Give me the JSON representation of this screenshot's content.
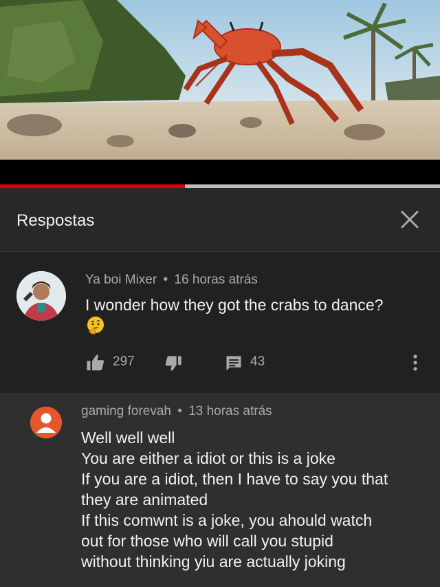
{
  "video": {
    "progress_fraction": 0.42,
    "accent_color": "#e00000"
  },
  "panel": {
    "title": "Respostas",
    "close_icon": "close-icon"
  },
  "parent_comment": {
    "author": "Ya boi Mixer",
    "separator": "•",
    "time": "16 horas atrás",
    "text": "I wonder how they got the crabs to dance?",
    "emoji": "thinking-face-emoji",
    "likes": "297",
    "replies": "43"
  },
  "reply_comment": {
    "author": "gaming forevah",
    "separator": "•",
    "time": "13 horas atrás",
    "lines": [
      "Well well well",
      "You are either a idiot or this is a joke",
      "If you are a idiot, then I have to say you that",
      "they are animated",
      "If this comwnt is a joke, you ahould watch",
      "out for those who will call you stupid",
      "without thinking yiu are actually joking"
    ],
    "avatar_color": "#e4572e"
  }
}
